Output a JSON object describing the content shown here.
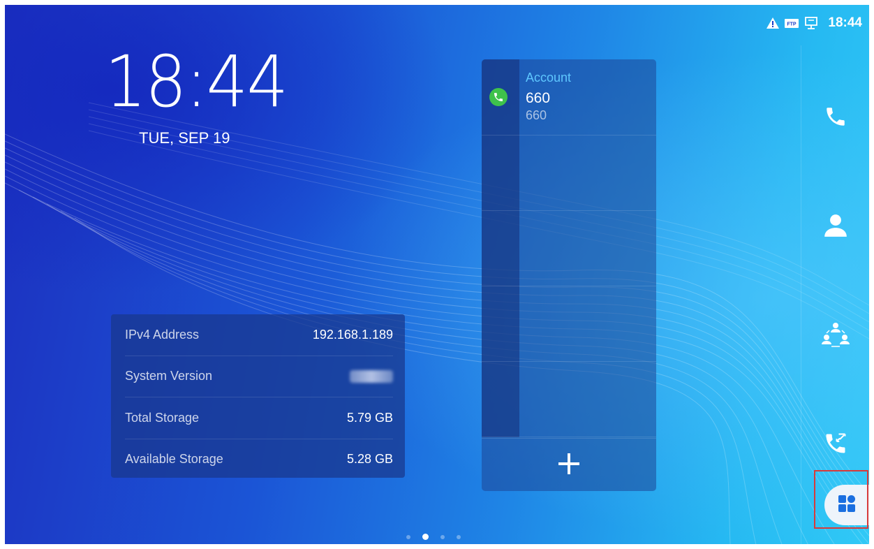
{
  "status_bar": {
    "time": "18:44",
    "icons": [
      "warning-icon",
      "ftp-icon",
      "network-icon"
    ],
    "ftp_text": "FTP"
  },
  "clock": {
    "time": "18:44",
    "date": "TUE, SEP 19"
  },
  "info_widget": {
    "rows": [
      {
        "label": "IPv4 Address",
        "value": "192.168.1.189"
      },
      {
        "label": "System Version",
        "value": ""
      },
      {
        "label": "Total Storage",
        "value": "5.79 GB"
      },
      {
        "label": "Available Storage",
        "value": "5.28 GB"
      }
    ]
  },
  "account_widget": {
    "label": "Account",
    "name": "660",
    "number": "660",
    "status_color": "#3fc24b",
    "add_icon": "plus-icon"
  },
  "dock": {
    "items": [
      "phone-icon",
      "contacts-icon",
      "conference-icon",
      "call-history-icon"
    ],
    "apps_icon": "apps-grid-icon",
    "apps_highlight_color": "#d83a3a"
  },
  "page_indicator": {
    "pages": 4,
    "active_index": 1
  },
  "colors": {
    "background_start": "#1c2fbf",
    "background_end": "#30c9f6",
    "accent": "#5ec7ff"
  }
}
